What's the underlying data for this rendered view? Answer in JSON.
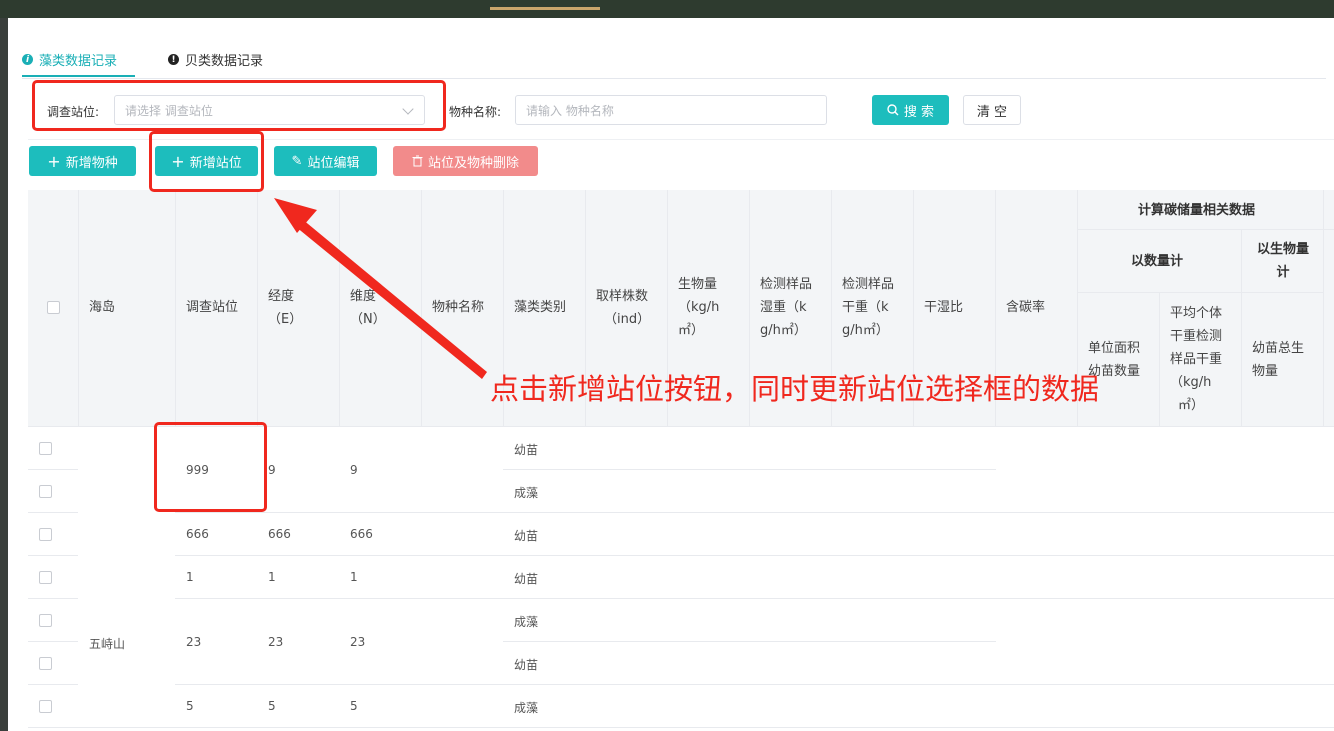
{
  "tabs": [
    {
      "label": "藻类数据记录",
      "active": true,
      "icon": "info-icon"
    },
    {
      "label": "贝类数据记录",
      "active": false,
      "icon": "alert-icon"
    }
  ],
  "filters": {
    "station_label": "调查站位:",
    "station_placeholder": "请选择 调查站位",
    "species_label": "物种名称:",
    "species_placeholder": "请输入 物种名称",
    "search_label": "搜 索",
    "clear_label": "清 空"
  },
  "toolbar": {
    "add_species": "新增物种",
    "add_station": "新增站位",
    "edit_station": "站位编辑",
    "delete_station": "站位及物种删除"
  },
  "table": {
    "headers": {
      "island": "海岛",
      "station": "调查站位",
      "longitude": [
        "经度",
        "（E）"
      ],
      "latitude": [
        "维度",
        "（N）"
      ],
      "species": "物种名称",
      "algae_type": "藻类类别",
      "sample_count": [
        "取样株数",
        "（ind）"
      ],
      "biomass": [
        "生物量",
        "（kg/h",
        "㎡）"
      ],
      "wet_weight": [
        "检测样品",
        "湿重（k",
        "g/h㎡）"
      ],
      "dry_weight": [
        "检测样品",
        "干重（k",
        "g/h㎡）"
      ],
      "dry_wet_ratio": "干湿比",
      "carbon_rate": "含碳率",
      "carbon_group": "计算碳储量相关数据",
      "by_count": "以数量计",
      "by_biomass": [
        "以生物量",
        "计"
      ],
      "unit_area_count": [
        "单位面积",
        "幼苗数量"
      ],
      "avg_dry_weight": [
        "平均个体",
        "干重检测",
        "样品干重",
        "（kg/h",
        "㎡）"
      ],
      "seedling_biomass": [
        "幼苗总生",
        "物量"
      ]
    },
    "island_value": "五峙山",
    "groups": [
      {
        "station": "999",
        "lon": "9",
        "lat": "9",
        "types": [
          "幼苗",
          "成藻"
        ]
      },
      {
        "station": "666",
        "lon": "666",
        "lat": "666",
        "types": [
          "幼苗"
        ]
      },
      {
        "station": "1",
        "lon": "1",
        "lat": "1",
        "types": [
          "幼苗"
        ]
      },
      {
        "station": "23",
        "lon": "23",
        "lat": "23",
        "types": [
          "成藻",
          "幼苗"
        ]
      },
      {
        "station": "5",
        "lon": "5",
        "lat": "5",
        "types": [
          "成藻"
        ]
      }
    ]
  },
  "annotation": {
    "text": "点击新增站位按钮，同时更新站位选择框的数据",
    "color": "#f0281e"
  },
  "colors": {
    "accent": "#1dbdbd",
    "danger": "#f28b8b",
    "annotation": "#f0281e"
  }
}
